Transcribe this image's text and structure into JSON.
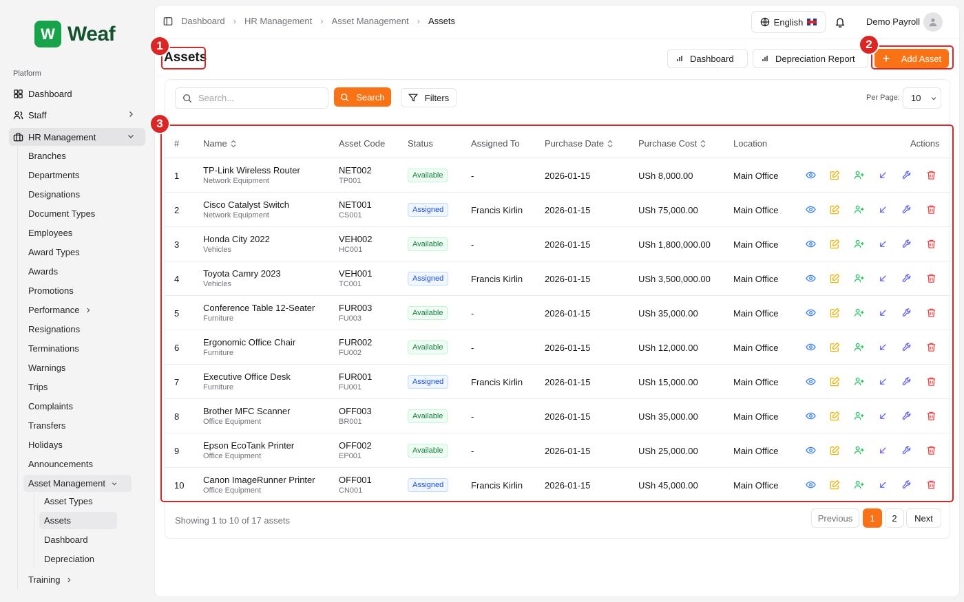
{
  "app": {
    "logo_mark": "W",
    "logo_text": "Weaf"
  },
  "sidebar": {
    "section": "Platform",
    "top_items": [
      {
        "label": "Dashboard"
      },
      {
        "label": "Staff"
      },
      {
        "label": "HR Management"
      }
    ],
    "hr_items": [
      "Branches",
      "Departments",
      "Designations",
      "Document Types",
      "Employees",
      "Award Types",
      "Awards",
      "Promotions",
      "Performance",
      "Resignations",
      "Terminations",
      "Warnings",
      "Trips",
      "Complaints",
      "Transfers",
      "Holidays",
      "Announcements",
      "Asset Management"
    ],
    "asset_items": [
      "Asset Types",
      "Assets",
      "Dashboard",
      "Depreciation"
    ],
    "training": "Training"
  },
  "header": {
    "breadcrumbs": [
      "Dashboard",
      "HR Management",
      "Asset Management",
      "Assets"
    ],
    "language": "English",
    "user_name": "Demo Payroll"
  },
  "page": {
    "title": "Assets",
    "dashboard_btn": "Dashboard",
    "depreciation_btn": "Depreciation Report",
    "add_btn": "Add Asset"
  },
  "toolbar": {
    "search_placeholder": "Search...",
    "search_btn": "Search",
    "filters_btn": "Filters",
    "per_page_label": "Per Page:",
    "per_page_value": "10"
  },
  "table": {
    "columns": [
      "#",
      "Name",
      "Asset Code",
      "Status",
      "Assigned To",
      "Purchase Date",
      "Purchase Cost",
      "Location",
      "Actions"
    ],
    "rows": [
      {
        "num": "1",
        "name": "TP-Link Wireless Router",
        "type": "Network Equipment",
        "code": "NET002",
        "subcode": "TP001",
        "status": "Available",
        "assigned": "-",
        "date": "2026-01-15",
        "cost": "USh 8,000.00",
        "location": "Main Office"
      },
      {
        "num": "2",
        "name": "Cisco Catalyst Switch",
        "type": "Network Equipment",
        "code": "NET001",
        "subcode": "CS001",
        "status": "Assigned",
        "assigned": "Francis Kirlin",
        "date": "2026-01-15",
        "cost": "USh 75,000.00",
        "location": "Main Office"
      },
      {
        "num": "3",
        "name": "Honda City 2022",
        "type": "Vehicles",
        "code": "VEH002",
        "subcode": "HC001",
        "status": "Available",
        "assigned": "-",
        "date": "2026-01-15",
        "cost": "USh 1,800,000.00",
        "location": "Main Office"
      },
      {
        "num": "4",
        "name": "Toyota Camry 2023",
        "type": "Vehicles",
        "code": "VEH001",
        "subcode": "TC001",
        "status": "Assigned",
        "assigned": "Francis Kirlin",
        "date": "2026-01-15",
        "cost": "USh 3,500,000.00",
        "location": "Main Office"
      },
      {
        "num": "5",
        "name": "Conference Table 12-Seater",
        "type": "Furniture",
        "code": "FUR003",
        "subcode": "FU003",
        "status": "Available",
        "assigned": "-",
        "date": "2026-01-15",
        "cost": "USh 35,000.00",
        "location": "Main Office"
      },
      {
        "num": "6",
        "name": "Ergonomic Office Chair",
        "type": "Furniture",
        "code": "FUR002",
        "subcode": "FU002",
        "status": "Available",
        "assigned": "-",
        "date": "2026-01-15",
        "cost": "USh 12,000.00",
        "location": "Main Office"
      },
      {
        "num": "7",
        "name": "Executive Office Desk",
        "type": "Furniture",
        "code": "FUR001",
        "subcode": "FU001",
        "status": "Assigned",
        "assigned": "Francis Kirlin",
        "date": "2026-01-15",
        "cost": "USh 15,000.00",
        "location": "Main Office"
      },
      {
        "num": "8",
        "name": "Brother MFC Scanner",
        "type": "Office Equipment",
        "code": "OFF003",
        "subcode": "BR001",
        "status": "Available",
        "assigned": "-",
        "date": "2026-01-15",
        "cost": "USh 35,000.00",
        "location": "Main Office"
      },
      {
        "num": "9",
        "name": "Epson EcoTank Printer",
        "type": "Office Equipment",
        "code": "OFF002",
        "subcode": "EP001",
        "status": "Available",
        "assigned": "-",
        "date": "2026-01-15",
        "cost": "USh 25,000.00",
        "location": "Main Office"
      },
      {
        "num": "10",
        "name": "Canon ImageRunner Printer",
        "type": "Office Equipment",
        "code": "OFF001",
        "subcode": "CN001",
        "status": "Assigned",
        "assigned": "Francis Kirlin",
        "date": "2026-01-15",
        "cost": "USh 45,000.00",
        "location": "Main Office"
      }
    ],
    "action_icons": [
      "eye-icon",
      "edit-icon",
      "user-plus-icon",
      "arrow-down-left-icon",
      "wrench-icon",
      "trash-icon"
    ]
  },
  "pagination": {
    "summary": "Showing 1 to 10 of 17 assets",
    "previous": "Previous",
    "pages": [
      "1",
      "2"
    ],
    "next": "Next"
  },
  "callouts": [
    "1",
    "2",
    "3"
  ],
  "colors": {
    "accent": "#f97316",
    "callout": "#dc2626",
    "available": "#15803d",
    "assigned": "#1d4ed8"
  }
}
